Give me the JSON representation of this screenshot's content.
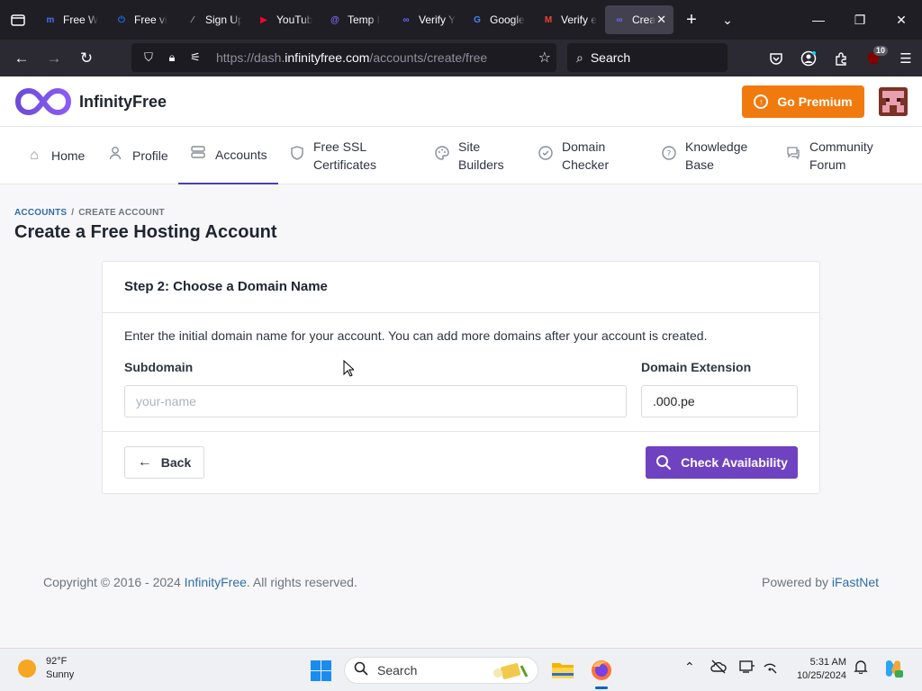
{
  "browser": {
    "tabs": [
      {
        "label": "Free W",
        "favicon": "m-logo-icon",
        "color": "#4a6cf7"
      },
      {
        "label": "Free vi",
        "favicon": "power-icon",
        "color": "#1a73e8"
      },
      {
        "label": "Sign Up",
        "favicon": "slash-icon",
        "color": "#9aa0a6"
      },
      {
        "label": "YouTub",
        "favicon": "youtube-icon",
        "color": "#ff0033"
      },
      {
        "label": "Temp I",
        "favicon": "at-icon",
        "color": "#7b6cf6"
      },
      {
        "label": "Verify Y",
        "favicon": "infinity-icon",
        "color": "#6f6cf6"
      },
      {
        "label": "Google",
        "favicon": "google-icon",
        "color": "#4285f4"
      },
      {
        "label": "Verify e",
        "favicon": "gmail-icon",
        "color": "#ea4335"
      },
      {
        "label": "Crea",
        "favicon": "infinity-icon",
        "color": "#6f6cf6",
        "active": true
      }
    ],
    "url_prefix": "https://dash.",
    "url_domain": "infinityfree.com",
    "url_suffix": "/accounts/create/free",
    "search_placeholder": "Search",
    "extensions_badge": "10"
  },
  "header": {
    "logo_text": "InfinityFree",
    "premium_label": "Go Premium"
  },
  "nav": {
    "items": [
      {
        "label": "Home",
        "icon": "home-icon"
      },
      {
        "label": "Profile",
        "icon": "user-icon"
      },
      {
        "label": "Accounts",
        "icon": "server-icon",
        "active": true
      },
      {
        "label": "Free SSL Certificates",
        "icon": "shield-icon"
      },
      {
        "label": "Site Builders",
        "icon": "palette-icon"
      },
      {
        "label": "Domain Checker",
        "icon": "check-circle-icon"
      },
      {
        "label": "Knowledge Base",
        "icon": "help-circle-icon"
      },
      {
        "label": "Community Forum",
        "icon": "chat-icon"
      }
    ]
  },
  "page": {
    "breadcrumb": [
      "Accounts",
      "Create Account"
    ],
    "breadcrumb_sep": "/",
    "title": "Create a Free Hosting Account"
  },
  "form": {
    "step_title": "Step 2: Choose a Domain Name",
    "intro": "Enter the initial domain name for your account. You can add more domains after your account is created.",
    "subdomain_label": "Subdomain",
    "subdomain_placeholder": "your-name",
    "subdomain_value": "",
    "extension_label": "Domain Extension",
    "extension_value": ".000.pe",
    "back_label": "Back",
    "check_label": "Check Availability"
  },
  "footer": {
    "copyright_prefix": "Copyright © 2016 - 2024 ",
    "copyright_link": "InfinityFree",
    "copyright_suffix": ". All rights reserved.",
    "powered_prefix": "Powered by ",
    "powered_link": "iFastNet"
  },
  "taskbar": {
    "weather_temp": "92°F",
    "weather_desc": "Sunny",
    "search_label": "Search",
    "time": "5:31 AM",
    "date": "10/25/2024"
  },
  "colors": {
    "accent": "#6f42c1",
    "premium": "#f17a0e",
    "link": "#2f6ea8"
  }
}
